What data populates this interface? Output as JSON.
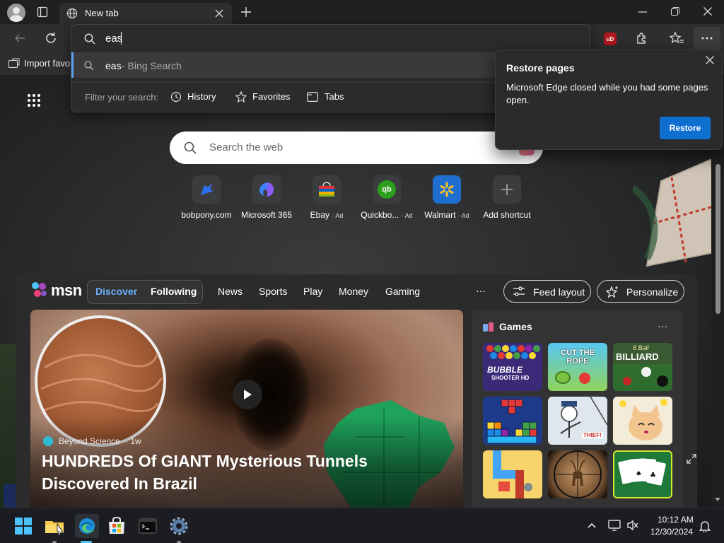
{
  "browser": {
    "tab_title": "New tab",
    "address_value": "eas",
    "favorites_import": "Import favor",
    "accent": "#0e6fd1"
  },
  "omnibox": {
    "suggestion_query": "eas",
    "suggestion_source": " - Bing Search",
    "filter_label": "Filter your search:",
    "filters": [
      "History",
      "Favorites",
      "Tabs"
    ]
  },
  "restore_popup": {
    "title": "Restore pages",
    "message": "Microsoft Edge closed while you had some pages open.",
    "button": "Restore"
  },
  "newtab": {
    "search_placeholder": "Search the web",
    "shortcuts": [
      {
        "label": "bobpony.com",
        "ad": ""
      },
      {
        "label": "Microsoft 365",
        "ad": ""
      },
      {
        "label": "Ebay",
        "ad": "· Ad"
      },
      {
        "label": "Quickbo...",
        "ad": "· Ad"
      },
      {
        "label": "Walmart",
        "ad": "· Ad"
      },
      {
        "label": "Add shortcut",
        "ad": ""
      }
    ]
  },
  "msn": {
    "logo": "msn",
    "tabs": [
      "Discover",
      "Following"
    ],
    "nav": [
      "News",
      "Sports",
      "Play",
      "Money",
      "Gaming"
    ],
    "more": "···",
    "feed_layout": "Feed layout",
    "personalize": "Personalize",
    "hero": {
      "source": "Beyond Science",
      "age": "· 1w",
      "headline": "HUNDREDS Of GIANT Mysterious Tunnels Discovered In Brazil"
    },
    "games": {
      "title": "Games",
      "more": "···",
      "tiles": [
        "BUBBLE",
        "SHOOTER HD",
        "CUT THE ROPE",
        "8 Ball",
        "BILLIARD",
        "THIEF!"
      ]
    }
  },
  "taskbar": {
    "time": "10:12 AM",
    "date": "12/30/2024"
  }
}
